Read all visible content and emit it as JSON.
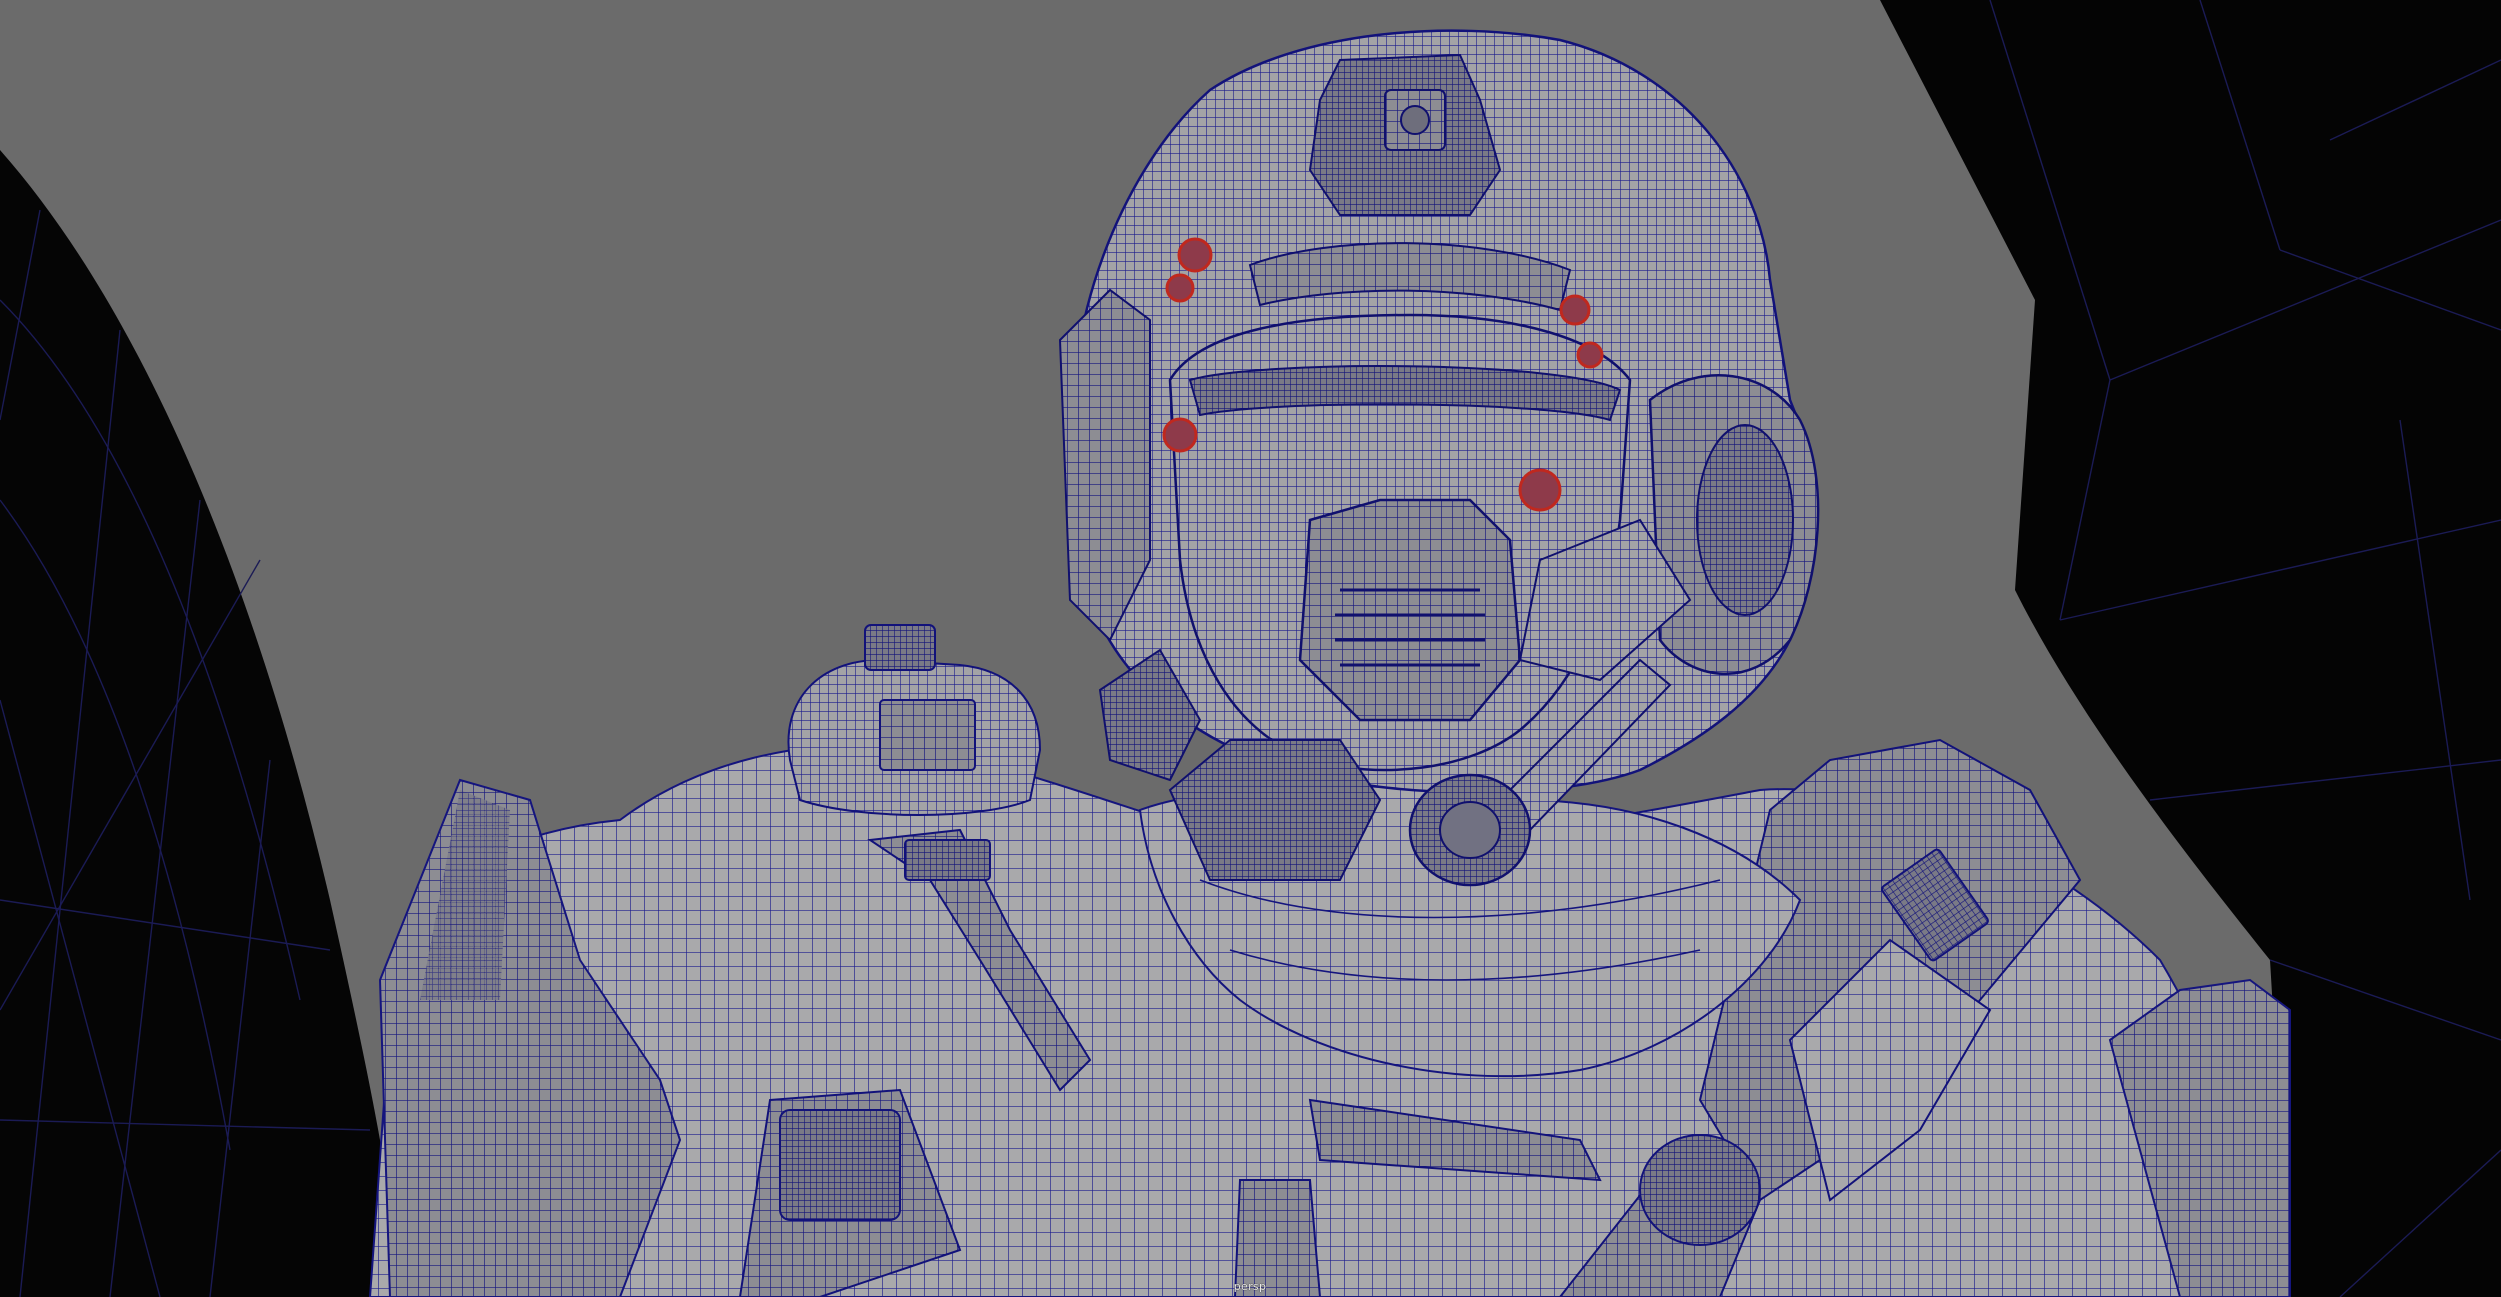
{
  "viewport": {
    "camera_label": "persp",
    "background_color": "#6b6b6b",
    "wireframe_color": "#1a1a8c",
    "mesh_fill_color": "#a8a8a8",
    "surrounding_geometry_color": "#050505",
    "selected_component_color": "#c0281e",
    "shading_mode": "wireframe-on-shaded"
  },
  "scene": {
    "subject": "armored-soldier-helmet-mesh"
  }
}
